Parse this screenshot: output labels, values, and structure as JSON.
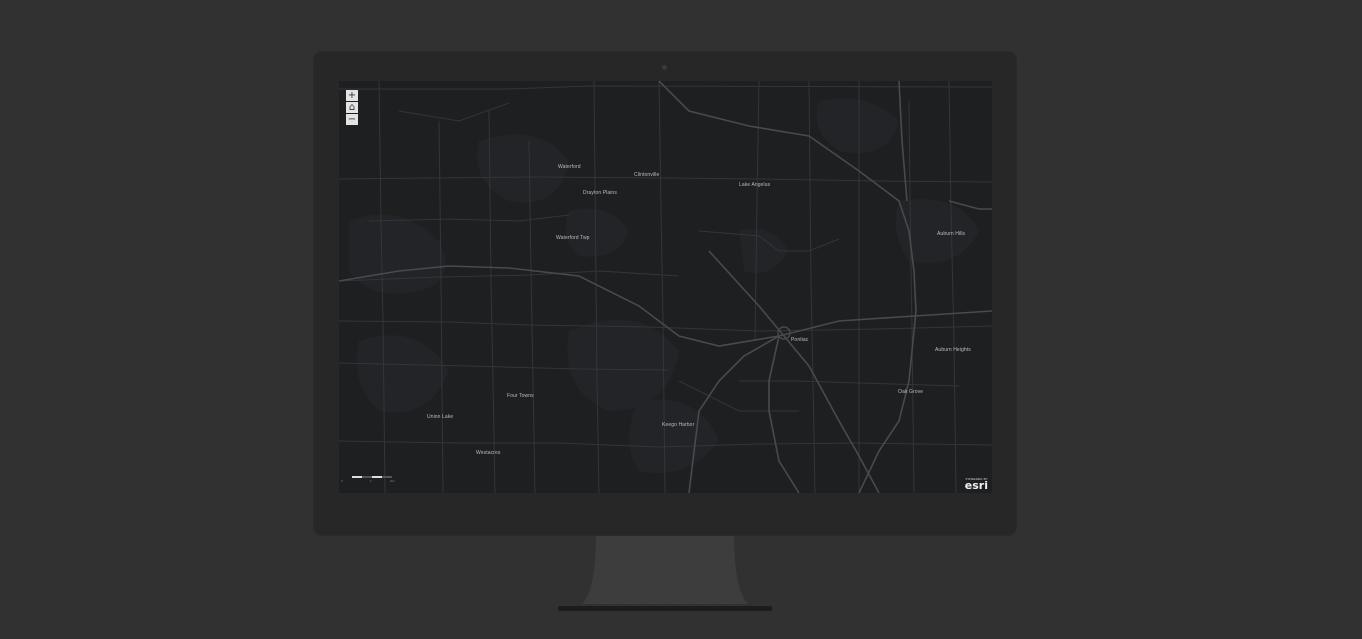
{
  "map": {
    "zoom_in_label": "+",
    "home_label": "⌂",
    "zoom_out_label": "−",
    "places": [
      {
        "name": "Waterford"
      },
      {
        "name": "Clintonville"
      },
      {
        "name": "Drayton Plains"
      },
      {
        "name": "Lake Angelus"
      },
      {
        "name": "Waterford Twp"
      },
      {
        "name": "Auburn Hills"
      },
      {
        "name": "Pontiac"
      },
      {
        "name": "Auburn Heights"
      },
      {
        "name": "Oak Grove"
      },
      {
        "name": "Four Towns"
      },
      {
        "name": "Union Lake"
      },
      {
        "name": "Keego Harbor"
      },
      {
        "name": "Westacres"
      }
    ],
    "scale": {
      "left_label": "0",
      "mid_label": "1",
      "right_label": "2mi"
    },
    "attribution": {
      "powered": "POWERED BY",
      "brand": "esri"
    }
  },
  "colors": {
    "page_bg": "#313131",
    "bezel": "#272728",
    "map_bg": "#1e1f21",
    "road": "#3a3b3e",
    "highway": "#4a4b4f",
    "label": "#bdbdbd"
  }
}
